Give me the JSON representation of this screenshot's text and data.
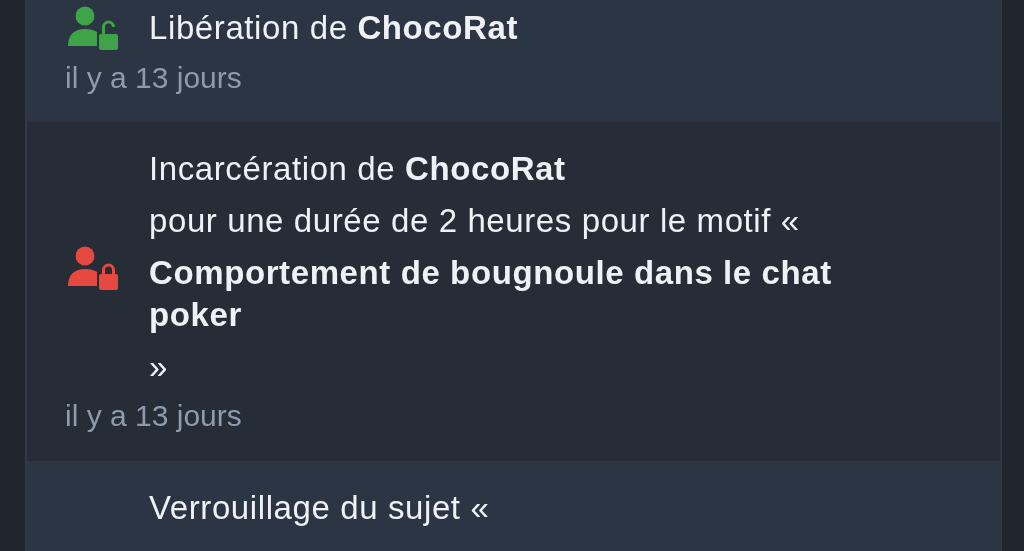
{
  "events": [
    {
      "kind": "unlocked",
      "lines": [
        {
          "text": "Libération de **ChocoRat**",
          "bold": false
        }
      ],
      "time": "il y a 13 jours"
    },
    {
      "kind": "locked",
      "lines": [
        {
          "text": "Incarcération de **ChocoRat**",
          "bold": false
        },
        {
          "text": "pour une durée de 2 heures pour le motif «",
          "bold": false
        },
        {
          "text": "Comportement de bougnoule dans le chat poker",
          "bold": true
        },
        {
          "text": "»",
          "bold": false
        }
      ],
      "time": "il y a 13 jours"
    },
    {
      "lines": [
        {
          "text": "Verrouillage du sujet «",
          "bold": false
        }
      ]
    }
  ]
}
